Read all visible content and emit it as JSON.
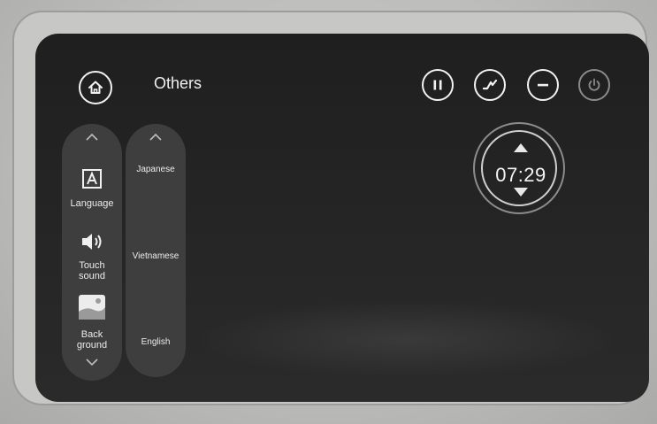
{
  "header": {
    "title": "Others"
  },
  "settings_menu": {
    "items": [
      {
        "label": "Language",
        "icon": "language-icon"
      },
      {
        "label": "Touch\nsound",
        "icon": "speaker-icon"
      },
      {
        "label": "Back\nground",
        "icon": "background-image-icon"
      }
    ]
  },
  "language_options": [
    "Japanese",
    "Vietnamese",
    "English"
  ],
  "timer": {
    "value": "07:29"
  },
  "toolbar": {
    "icons": [
      "pause-icon",
      "activity-icon",
      "minus-icon",
      "power-icon"
    ]
  }
}
